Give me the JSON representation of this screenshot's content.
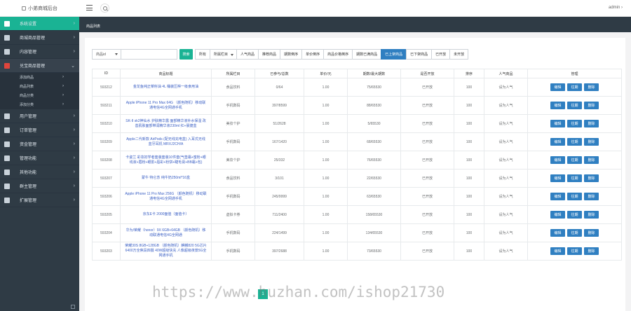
{
  "header": {
    "brand": "小弟商城后台",
    "user": "admin ›"
  },
  "sidebar": {
    "items": [
      {
        "label": "系统设置",
        "icon": "monitor-icon"
      },
      {
        "label": "商城商品管理",
        "icon": "grid-icon"
      },
      {
        "label": "内容管理",
        "icon": "list-icon"
      },
      {
        "label": "兑宝商品管理",
        "icon": "tag-icon"
      },
      {
        "label": "用户管理",
        "icon": "user-icon"
      },
      {
        "label": "订单管理",
        "icon": "order-icon"
      },
      {
        "label": "资金管理",
        "icon": "money-icon"
      },
      {
        "label": "管理功能",
        "icon": "gear-icon"
      },
      {
        "label": "其他功能",
        "icon": "calendar-icon"
      },
      {
        "label": "群主管理",
        "icon": "group-icon"
      },
      {
        "label": "扩展管理",
        "icon": "wrench-icon"
      }
    ],
    "subitems": [
      "添加商品",
      "商品列表",
      "商品分类",
      "添加分类"
    ]
  },
  "tabs": [
    "商品列表"
  ],
  "toolbar": {
    "select_label": "商品id",
    "search_placeholder": "",
    "search_button": "搜索",
    "filters": [
      "所有",
      "所属栏目",
      "人气商品",
      "推荐商品",
      "期数倒序",
      "单价倒序",
      "商品价格倒序",
      "期数已满商品",
      "已上架商品",
      "已下架商品",
      "已开放",
      "未开放"
    ],
    "active_filter": "已上架商品"
  },
  "table": {
    "headers": [
      "ID",
      "商品标题",
      "所属栏目",
      "已参与/总数",
      "单价/元",
      "期数/最大期数",
      "是否开放",
      "排序",
      "人气商品",
      "管理"
    ],
    "rows": [
      {
        "id": "593212",
        "title": "金龙鱼纯正菜籽油 4L 桶装压榨一级食用油",
        "cat": "食品饮料",
        "joined": "0/64",
        "price": "1.00",
        "periods": "75/65530",
        "open": "已开放",
        "sort": "100",
        "hot": "设为人气"
      },
      {
        "id": "593211",
        "title": "Apple iPhone 11 Pro Max 64G （颜色随机）移动联通电信4G全网通手机",
        "cat": "手机数码",
        "joined": "397/8599",
        "price": "1.00",
        "periods": "88/65530",
        "open": "已开放",
        "sort": "100",
        "hot": "设为人气"
      },
      {
        "id": "593210",
        "title": "SK-II sk2神仙水 护肤精华露 面部精华液补水保湿 改善肌肤面部带润精华液230ml 红+晨捷盒",
        "cat": "美妆个护",
        "joined": "51/2628",
        "price": "1.00",
        "periods": "5/65530",
        "open": "已开放",
        "sort": "100",
        "hot": "设为人气"
      },
      {
        "id": "593209",
        "title": "Apple二代新款 AirPods (配无线充电盒) 入耳式无线蓝牙耳机 MRXJ2CH/A",
        "cat": "手机数码",
        "joined": "167/1420",
        "price": "1.00",
        "periods": "68/65530",
        "open": "已开放",
        "sort": "100",
        "hot": "设为人气"
      },
      {
        "id": "593208",
        "title": "卡姿兰 彩妆初学者套装套装10件套(气垫霜+蜜粉+眼线液+眉粉+眼影+唇彩+粉饼+睫毛膏+BB霜+包)",
        "cat": "美妆个护",
        "joined": "25/332",
        "price": "1.00",
        "periods": "76/65530",
        "open": "已开放",
        "sort": "100",
        "hot": "设为人气"
      },
      {
        "id": "593207",
        "title": "蒙牛 特仑苏 纯牛奶250ml*16盒",
        "cat": "食品饮料",
        "joined": "3/101",
        "price": "1.00",
        "periods": "22/65530",
        "open": "已开放",
        "sort": "100",
        "hot": "设为人气"
      },
      {
        "id": "593206",
        "title": "Apple iPhone 11 Pro Max 256G （颜色随机）移动联通电信4G全网通手机",
        "cat": "手机数码",
        "joined": "245/9999",
        "price": "1.00",
        "periods": "63/65530",
        "open": "已开放",
        "sort": "100",
        "hot": "设为人气"
      },
      {
        "id": "593205",
        "title": "京东E卡 2000面值（面值卡）",
        "cat": "虚拟卡券",
        "joined": "711/2400",
        "price": "1.00",
        "periods": "158/65530",
        "open": "已开放",
        "sort": "100",
        "hot": "设为人气"
      },
      {
        "id": "593204",
        "title": "华为/荣耀（honor）9X 6GB+64GB （颜色随机）移动联通电信4G全网通",
        "cat": "手机数码",
        "joined": "224/1499",
        "price": "1.00",
        "periods": "134/65530",
        "open": "已开放",
        "sort": "100",
        "hot": "设为人气"
      },
      {
        "id": "593203",
        "title": "荣耀30S 8GB+128GB （颜色随机）麒麟820 5G芯片 6400万全焦段四摄 40W超级快充 人像超级夜景5G全网通手机",
        "cat": "手机数码",
        "joined": "397/2688",
        "price": "1.00",
        "periods": "73/65530",
        "open": "已开放",
        "sort": "100",
        "hot": "设为人气"
      }
    ],
    "actions": [
      "编辑",
      "往期",
      "删除"
    ]
  },
  "pagination": {
    "current": "1"
  },
  "watermark": "https://www.huzhan.com/ishop21730",
  "colors": {
    "sidebar": "#2f3b45",
    "teal": "#1ab394",
    "blue": "#2f7fc1",
    "link": "#3a5fc4"
  }
}
